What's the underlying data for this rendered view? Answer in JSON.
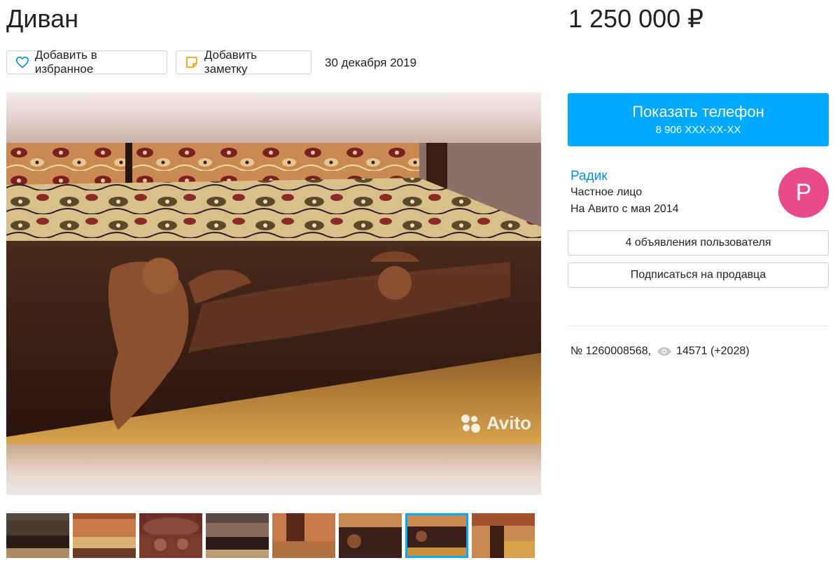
{
  "listing": {
    "title": "Диван",
    "price": "1 250 000 ₽",
    "date": "30 декабря 2019"
  },
  "actions": {
    "favorite_label": "Добавить в избранное",
    "note_label": "Добавить заметку"
  },
  "gallery": {
    "watermark": "Avito",
    "thumbnail_count": 8,
    "active_thumbnail": 7
  },
  "contact": {
    "button_label": "Показать телефон",
    "phone_masked": "8 906 XXX-XX-XX"
  },
  "seller": {
    "name": "Радик",
    "type": "Частное лицо",
    "since": "На Авито с мая 2014",
    "avatar_letter": "Р",
    "avatar_color": "#e94b8a",
    "listings_button": "4 объявления пользователя",
    "subscribe_button": "Подписаться на продавца"
  },
  "meta": {
    "item_number": "№ 1260008568,",
    "views": "14571 (+2028)"
  },
  "colors": {
    "accent": "#00aaff",
    "link": "#0091d9"
  }
}
